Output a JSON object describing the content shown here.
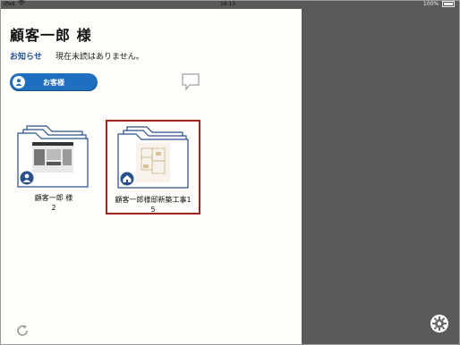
{
  "status_bar": {
    "device": "iPad",
    "time": "16:15",
    "battery": "100%"
  },
  "header": {
    "title": "顧客一郎 様"
  },
  "notice": {
    "label": "お知らせ",
    "text": "現在未読はありません。"
  },
  "customer_button": {
    "label": "お客様"
  },
  "folders": [
    {
      "name": "顧客一郎 様",
      "count": "2"
    },
    {
      "name": "顧客一郎様邸新築工事1",
      "count": "5"
    }
  ],
  "colors": {
    "accent": "#1f6fc0",
    "selection": "#a81e1e",
    "background": "#5a5a5a",
    "panel": "#fffdfa"
  },
  "icons": [
    "wifi-icon",
    "battery-icon",
    "user-icon",
    "comment-icon",
    "home-icon",
    "refresh-icon",
    "gear-icon"
  ]
}
